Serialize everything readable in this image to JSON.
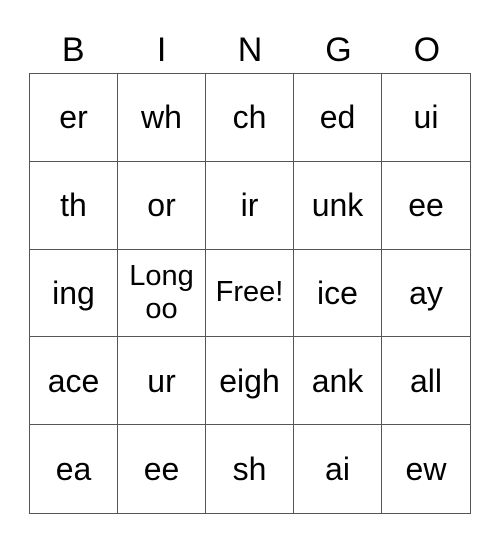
{
  "header": [
    "B",
    "I",
    "N",
    "G",
    "O"
  ],
  "cells": [
    [
      "er",
      "wh",
      "ch",
      "ed",
      "ui"
    ],
    [
      "th",
      "or",
      "ir",
      "unk",
      "ee"
    ],
    [
      "ing",
      "Long oo",
      "Free!",
      "ice",
      "ay"
    ],
    [
      "ace",
      "ur",
      "eigh",
      "ank",
      "all"
    ],
    [
      "ea",
      "ee",
      "sh",
      "ai",
      "ew"
    ]
  ]
}
